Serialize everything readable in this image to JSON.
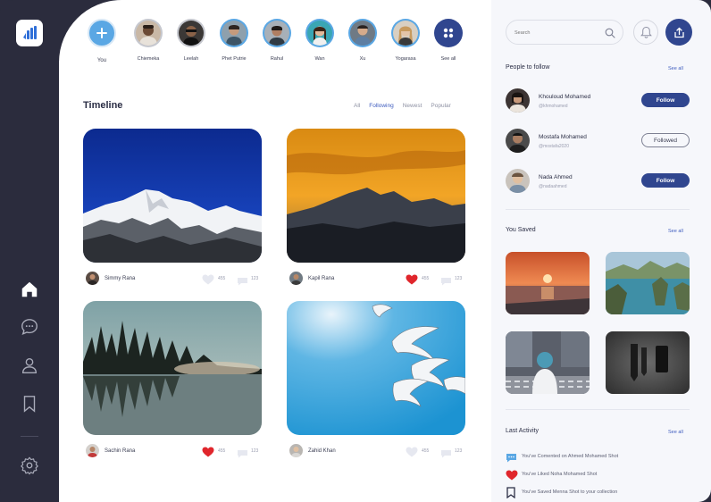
{
  "stories": {
    "you": "You",
    "people": [
      "Chiemeka",
      "Leelah",
      "Phet Putrie",
      "Rahul",
      "Wan",
      "Xu",
      "Yogarasa"
    ],
    "see_all": "See all"
  },
  "timeline": {
    "title": "Timeline",
    "filters": [
      "All",
      "Following",
      "Newest",
      "Popular"
    ],
    "active_filter": "Following",
    "posts": [
      {
        "author": "Simmy Rana",
        "likes": "455",
        "comments": "123",
        "liked": false
      },
      {
        "author": "Kapil Rana",
        "likes": "455",
        "comments": "123",
        "liked": true
      },
      {
        "author": "Sachin Rana",
        "likes": "455",
        "comments": "123",
        "liked": true
      },
      {
        "author": "Zahid Khan",
        "likes": "455",
        "comments": "123",
        "liked": false
      }
    ]
  },
  "search": {
    "placeholder": "Search"
  },
  "people_to_follow": {
    "title": "People to follow",
    "see_all": "See all",
    "people": [
      {
        "name": "Khouloud Mohamed",
        "handle": "@khmohamed",
        "button": "Follow"
      },
      {
        "name": "Mostafa Mohamed",
        "handle": "@mostafa2020",
        "button": "Followed"
      },
      {
        "name": "Nada Ahmed",
        "handle": "@nadaahmed",
        "button": "Follow"
      }
    ]
  },
  "you_saved": {
    "title": "You Saved",
    "see_all": "See all"
  },
  "last_activity": {
    "title": "Last Activity",
    "see_all": "See all",
    "items": [
      {
        "icon": "comment-icon",
        "text": "You've Comented on Ahmed Mohamed Shot"
      },
      {
        "icon": "heart-icon",
        "text": "You've Liked Noha Mohamed Shot"
      },
      {
        "icon": "bookmark-icon",
        "text": "You've Saved Menna Shot to your collection"
      }
    ]
  },
  "colors": {
    "accent": "#30468f",
    "story_ring": "#5aa7e4",
    "like": "#e0262c",
    "nav": "#2b2c3d"
  }
}
